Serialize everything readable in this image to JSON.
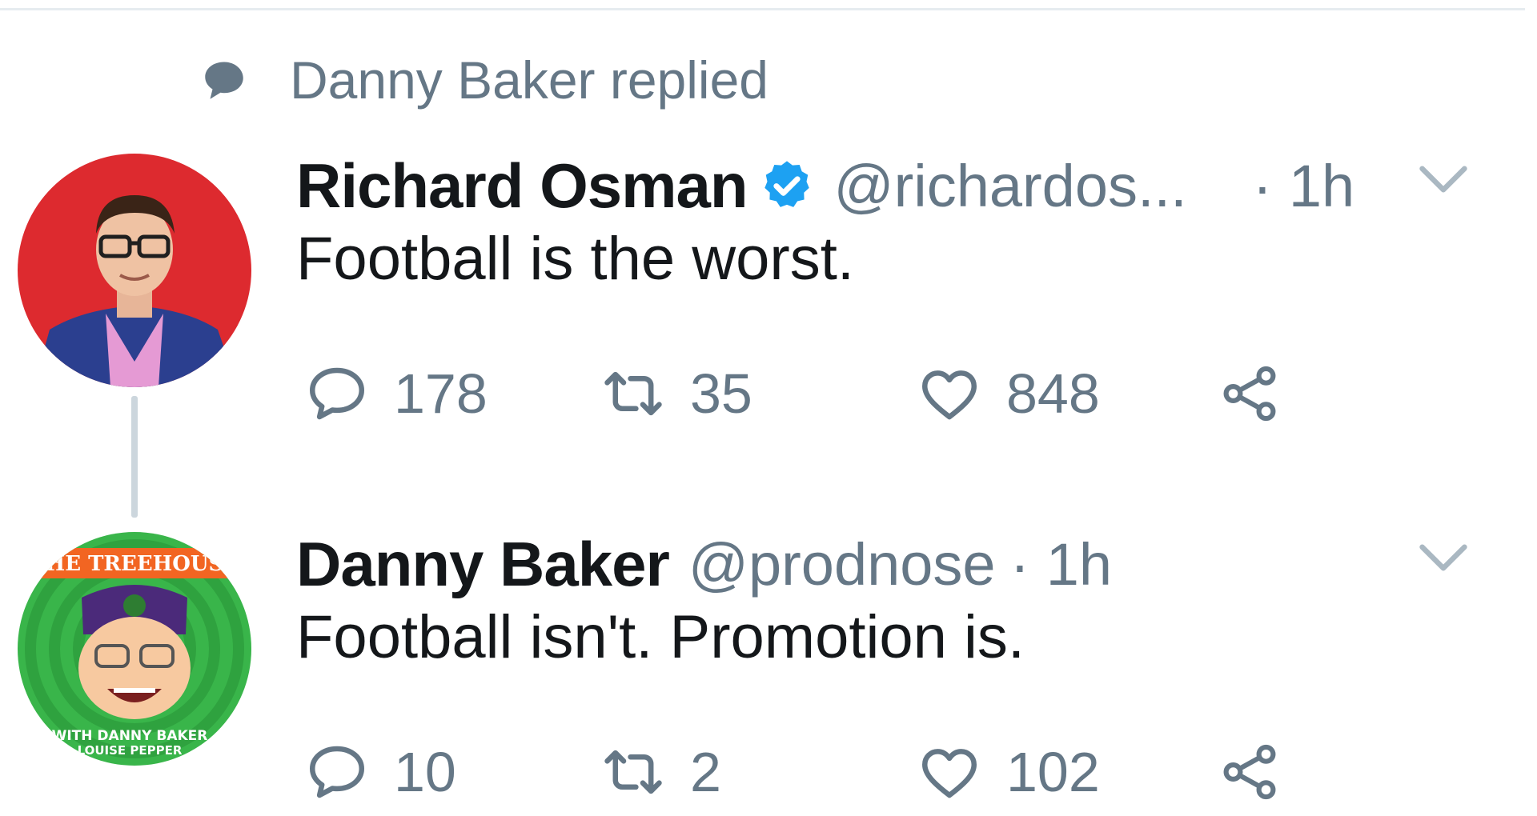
{
  "context": {
    "icon": "speech-bubble-icon",
    "text": "Danny Baker replied"
  },
  "colors": {
    "text_primary": "#14171a",
    "text_secondary": "#657786",
    "verified_blue": "#1da1f2",
    "thread_line": "#ccd6dd"
  },
  "tweets": [
    {
      "display_name": "Richard Osman",
      "verified": true,
      "handle": "@richardos...",
      "time": "· 1h",
      "text": "Football is the worst.",
      "avatar": "avatar-photo-red-background",
      "actions": {
        "replies": "178",
        "retweets": "35",
        "likes": "848"
      }
    },
    {
      "display_name": "Danny Baker",
      "verified": false,
      "handle": "@prodnose",
      "time": "· 1h",
      "text": "Football isn't. Promotion is.",
      "avatar": "avatar-treehouse-cartoon",
      "avatar_text_top": "HE TREEHOUS",
      "avatar_text_bottom": "WITH DANNY BAKER",
      "avatar_text_bottom2": "LOUISE PEPPER",
      "actions": {
        "replies": "10",
        "retweets": "2",
        "likes": "102"
      }
    }
  ]
}
